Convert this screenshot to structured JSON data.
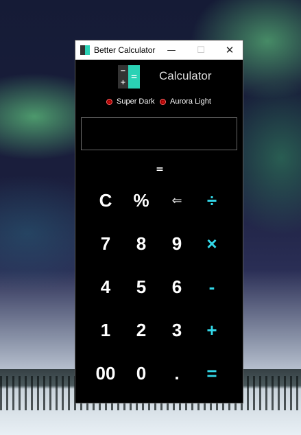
{
  "window": {
    "title": "Better Calculator",
    "controls": {
      "minimize": "—",
      "maximize": "☐",
      "close": "✕"
    }
  },
  "header": {
    "logo_glyphs": {
      "minus": "−",
      "plus": "+",
      "equals": "="
    },
    "title": "Calculator"
  },
  "themes": [
    {
      "label": "Super Dark",
      "selected": true
    },
    {
      "label": "Aurora Light",
      "selected": false
    }
  ],
  "display": {
    "value": ""
  },
  "result": "=",
  "keypad": [
    [
      "C",
      "%",
      "⇐",
      "÷"
    ],
    [
      "7",
      "8",
      "9",
      "×"
    ],
    [
      "4",
      "5",
      "6",
      "-"
    ],
    [
      "1",
      "2",
      "3",
      "+"
    ],
    [
      "00",
      "0",
      ".",
      "="
    ]
  ],
  "colors": {
    "accent": "#33d9ea",
    "logo_teal": "#2ad2b5",
    "radio_red": "#d01010",
    "window_bg": "#000000"
  }
}
